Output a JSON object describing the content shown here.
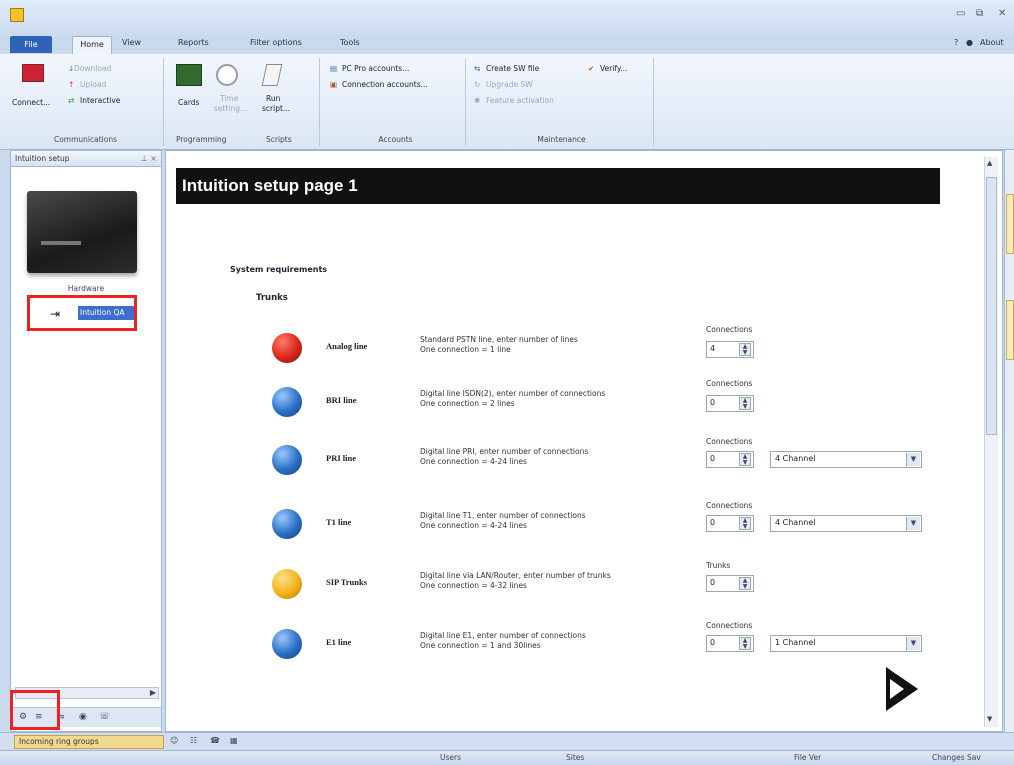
{
  "window": {
    "minimize": "▭",
    "restore": "⧉",
    "close": "✕"
  },
  "ribbon_tabs": {
    "file": "File",
    "home": "Home",
    "view": "View",
    "reports": "Reports",
    "filter": "Filter options",
    "tools": "Tools",
    "help": "?",
    "about": "About"
  },
  "ribbon": {
    "communications": {
      "label": "Communications",
      "connect": "Connect...",
      "download": "Download",
      "upload": "Upload",
      "interactive": "Interactive"
    },
    "programming": {
      "label": "Programming",
      "cards": "Cards",
      "time_line1": "Time",
      "time_line2": "setting...",
      "run_line1": "Run",
      "run_line2": "script...",
      "scripts": "Scripts"
    },
    "accounts": {
      "label": "Accounts",
      "pc_pro": "PC Pro accounts...",
      "connection": "Connection accounts..."
    },
    "maintenance": {
      "label": "Maintenance",
      "create_sw": "Create SW file",
      "verify": "Verify...",
      "upgrade_sw": "Upgrade SW",
      "feature": "Feature activation"
    }
  },
  "left_panel": {
    "title": "Intuition setup",
    "pin": "⊥ ×",
    "hardware_label": "Hardware",
    "tree_node": "Intuition QA"
  },
  "main": {
    "title": "Intuition setup page 1",
    "system_requirements": "System requirements",
    "trunks_heading": "Trunks",
    "rows": [
      {
        "name": "Analog line",
        "desc1": "Standard PSTN line, enter number of lines",
        "desc2": "One connection = 1 line",
        "field_label": "Connections",
        "value": "4",
        "select": ""
      },
      {
        "name": "BRI line",
        "desc1": "Digital line ISDN(2), enter number of connections",
        "desc2": "One connection = 2 lines",
        "field_label": "Connections",
        "value": "0",
        "select": ""
      },
      {
        "name": "PRI line",
        "desc1": "Digital line PRI, enter number of connections",
        "desc2": "One connection = 4-24 lines",
        "field_label": "Connections",
        "value": "0",
        "select": "4 Channel"
      },
      {
        "name": "T1 line",
        "desc1": "Digital line T1, enter number of connections",
        "desc2": "One connection = 4-24 lines",
        "field_label": "Connections",
        "value": "0",
        "select": "4 Channel"
      },
      {
        "name": "SIP Trunks",
        "desc1": "Digital line via LAN/Router, enter number of trunks",
        "desc2": "One connection = 4-32 lines",
        "field_label": "Trunks",
        "value": "0",
        "select": ""
      },
      {
        "name": "E1 line",
        "desc1": "Digital line E1, enter number of connections",
        "desc2": "One connection = 1 and 30lines",
        "field_label": "Connections",
        "value": "0",
        "select": "1 Channel"
      }
    ],
    "colors": {
      "analog": "#d9261c",
      "digital": "#2a6fc4",
      "sip": "#f2b21a"
    }
  },
  "bottom": {
    "doc_tab": "Incoming ring groups",
    "status": [
      "Users",
      "Sites",
      "File Ver",
      "Changes Sav"
    ]
  }
}
